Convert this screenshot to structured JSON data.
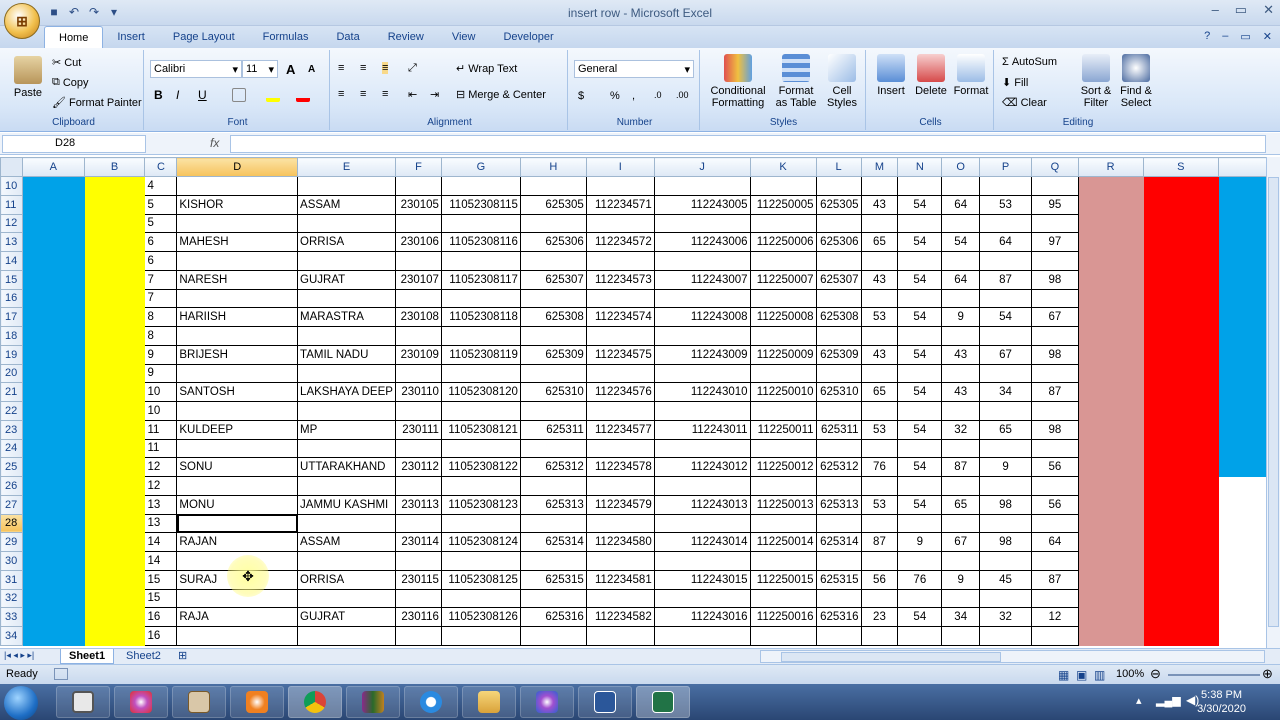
{
  "window": {
    "title": "insert row - Microsoft Excel",
    "office_button_glyph": "⊞",
    "min_glyph": "–",
    "restore_glyph": "▭",
    "close_glyph": "✕"
  },
  "ribbon_tabs": [
    "Home",
    "Insert",
    "Page Layout",
    "Formulas",
    "Data",
    "Review",
    "View",
    "Developer"
  ],
  "ribbon": {
    "clipboard": {
      "paste": "Paste",
      "cut": "Cut",
      "copy": "Copy",
      "format_painter": "Format Painter",
      "label": "Clipboard"
    },
    "font": {
      "name": "Calibri",
      "size": "11",
      "label": "Font",
      "bold": "B",
      "italic": "I",
      "underline": "U",
      "grow": "A",
      "shrink": "A"
    },
    "alignment": {
      "wrap_text": "Wrap Text",
      "merge_center": "Merge & Center",
      "label": "Alignment"
    },
    "number": {
      "format": "General",
      "currency": "$",
      "percent": "%",
      "comma": ",",
      "label": "Number"
    },
    "styles": {
      "conditional": "Conditional Formatting",
      "as_table": "Format as Table",
      "cell_styles": "Cell Styles",
      "label": "Styles"
    },
    "cells": {
      "insert": "Insert",
      "delete": "Delete",
      "format": "Format",
      "label": "Cells"
    },
    "editing": {
      "autosum": "AutoSum",
      "fill": "Fill",
      "clear": "Clear",
      "sort": "Sort & Filter",
      "find": "Find & Select",
      "label": "Editing"
    }
  },
  "formula_bar": {
    "name_box": "D28",
    "fx": "fx",
    "formula": ""
  },
  "columns": [
    "A",
    "B",
    "C",
    "D",
    "E",
    "F",
    "G",
    "H",
    "I",
    "J",
    "K",
    "L",
    "M",
    "N",
    "O",
    "P",
    "Q",
    "R",
    "S"
  ],
  "active_cell": "D28",
  "rows": [
    {
      "r": "10",
      "c": "4"
    },
    {
      "r": "11",
      "c": "5",
      "d": "KISHOR",
      "e": "ASSAM",
      "f": "230105",
      "g": "11052308115",
      "h": "625305",
      "i": "112234571",
      "j": "112243005",
      "k": "112250005",
      "l": "625305",
      "m": "43",
      "n": "54",
      "o": "64",
      "p": "53",
      "q": "95"
    },
    {
      "r": "12",
      "c": "5"
    },
    {
      "r": "13",
      "c": "6",
      "d": "MAHESH",
      "e": "ORRISA",
      "f": "230106",
      "g": "11052308116",
      "h": "625306",
      "i": "112234572",
      "j": "112243006",
      "k": "112250006",
      "l": "625306",
      "m": "65",
      "n": "54",
      "o": "54",
      "p": "64",
      "q": "97"
    },
    {
      "r": "14",
      "c": "6"
    },
    {
      "r": "15",
      "c": "7",
      "d": "NARESH",
      "e": "GUJRAT",
      "f": "230107",
      "g": "11052308117",
      "h": "625307",
      "i": "112234573",
      "j": "112243007",
      "k": "112250007",
      "l": "625307",
      "m": "43",
      "n": "54",
      "o": "64",
      "p": "87",
      "q": "98"
    },
    {
      "r": "16",
      "c": "7"
    },
    {
      "r": "17",
      "c": "8",
      "d": "HARIISH",
      "e": "MARASTRA",
      "f": "230108",
      "g": "11052308118",
      "h": "625308",
      "i": "112234574",
      "j": "112243008",
      "k": "112250008",
      "l": "625308",
      "m": "53",
      "n": "54",
      "o": "9",
      "p": "54",
      "q": "67"
    },
    {
      "r": "18",
      "c": "8"
    },
    {
      "r": "19",
      "c": "9",
      "d": "BRIJESH",
      "e": "TAMIL NADU",
      "f": "230109",
      "g": "11052308119",
      "h": "625309",
      "i": "112234575",
      "j": "112243009",
      "k": "112250009",
      "l": "625309",
      "m": "43",
      "n": "54",
      "o": "43",
      "p": "67",
      "q": "98"
    },
    {
      "r": "20",
      "c": "9"
    },
    {
      "r": "21",
      "c": "10",
      "d": "SANTOSH",
      "e": "LAKSHAYA DEEP",
      "f": "230110",
      "g": "11052308120",
      "h": "625310",
      "i": "112234576",
      "j": "112243010",
      "k": "112250010",
      "l": "625310",
      "m": "65",
      "n": "54",
      "o": "43",
      "p": "34",
      "q": "87"
    },
    {
      "r": "22",
      "c": "10"
    },
    {
      "r": "23",
      "c": "11",
      "d": "KULDEEP",
      "e": "MP",
      "f": "230111",
      "g": "11052308121",
      "h": "625311",
      "i": "112234577",
      "j": "112243011",
      "k": "112250011",
      "l": "625311",
      "m": "53",
      "n": "54",
      "o": "32",
      "p": "65",
      "q": "98"
    },
    {
      "r": "24",
      "c": "11"
    },
    {
      "r": "25",
      "c": "12",
      "d": "SONU",
      "e": "UTTARAKHAND",
      "f": "230112",
      "g": "11052308122",
      "h": "625312",
      "i": "112234578",
      "j": "112243012",
      "k": "112250012",
      "l": "625312",
      "m": "76",
      "n": "54",
      "o": "87",
      "p": "9",
      "q": "56"
    },
    {
      "r": "26",
      "c": "12"
    },
    {
      "r": "27",
      "c": "13",
      "d": "MONU",
      "e": "JAMMU KASHMI",
      "f": "230113",
      "g": "11052308123",
      "h": "625313",
      "i": "112234579",
      "j": "112243013",
      "k": "112250013",
      "l": "625313",
      "m": "53",
      "n": "54",
      "o": "65",
      "p": "98",
      "q": "56"
    },
    {
      "r": "28",
      "c": "13"
    },
    {
      "r": "29",
      "c": "14",
      "d": "RAJAN",
      "e": "ASSAM",
      "f": "230114",
      "g": "11052308124",
      "h": "625314",
      "i": "112234580",
      "j": "112243014",
      "k": "112250014",
      "l": "625314",
      "m": "87",
      "n": "9",
      "o": "67",
      "p": "98",
      "q": "64"
    },
    {
      "r": "30",
      "c": "14"
    },
    {
      "r": "31",
      "c": "15",
      "d": "SURAJ",
      "e": "ORRISA",
      "f": "230115",
      "g": "11052308125",
      "h": "625315",
      "i": "112234581",
      "j": "112243015",
      "k": "112250015",
      "l": "625315",
      "m": "56",
      "n": "76",
      "o": "9",
      "p": "45",
      "q": "87"
    },
    {
      "r": "32",
      "c": "15"
    },
    {
      "r": "33",
      "c": "16",
      "d": "RAJA",
      "e": "GUJRAT",
      "f": "230116",
      "g": "11052308126",
      "h": "625316",
      "i": "112234582",
      "j": "112243016",
      "k": "112250016",
      "l": "625316",
      "m": "23",
      "n": "54",
      "o": "34",
      "p": "32",
      "q": "12"
    },
    {
      "r": "34",
      "c": "16"
    }
  ],
  "colors": {
    "col_a": "#00a2e8",
    "col_b": "#ffff00",
    "col_r": "#d99694",
    "col_s": "#ff0000"
  },
  "sheets": [
    "Sheet1",
    "Sheet2"
  ],
  "active_sheet": "Sheet1",
  "status": {
    "ready": "Ready",
    "zoom": "100%"
  },
  "clock": {
    "time": "5:38 PM",
    "date": "3/30/2020"
  },
  "taskbar_icons": [
    "windows-explorer-icon",
    "paint-icon",
    "tally-erp-icon",
    "media-player-icon",
    "chrome-icon",
    "winrar-icon",
    "internet-explorer-icon",
    "folder-icon",
    "paint-icon",
    "word-icon",
    "excel-icon"
  ]
}
